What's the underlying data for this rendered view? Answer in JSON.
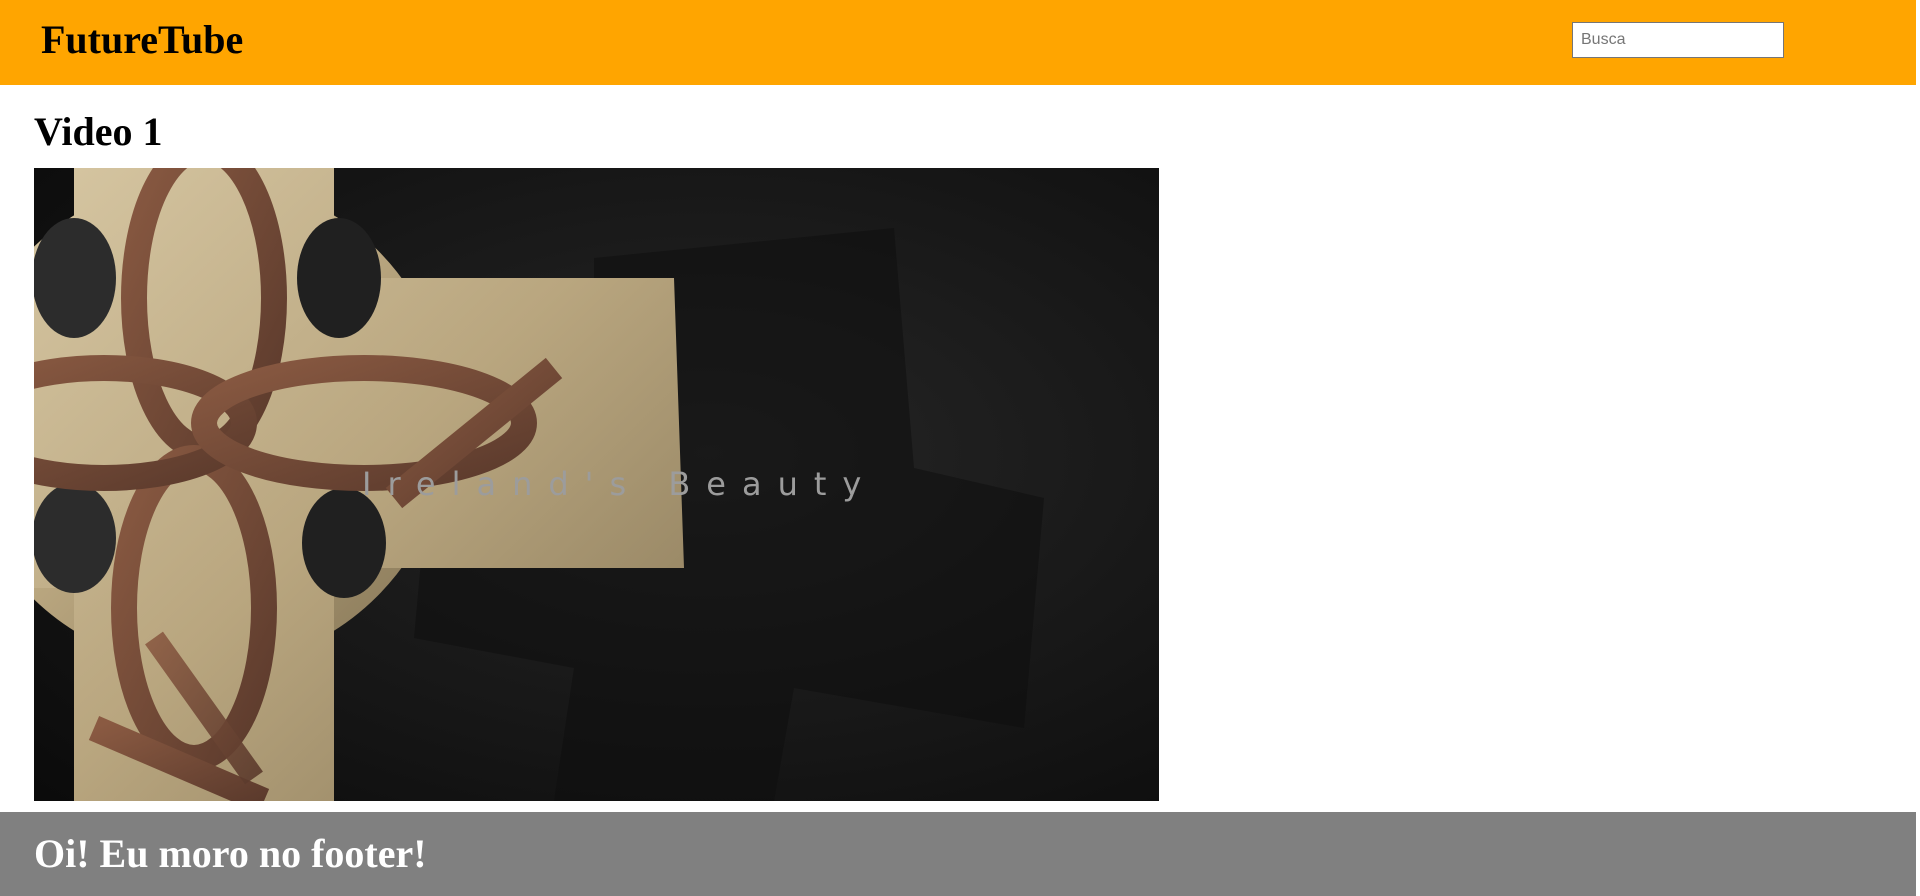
{
  "header": {
    "site_title": "FutureTube",
    "search_placeholder": "Busca",
    "background_color": "#ffa500"
  },
  "main": {
    "video_title": "Video 1",
    "video_overlay_text": "Ireland's Beauty"
  },
  "footer": {
    "text": "Oi! Eu moro no footer!",
    "background_color": "#808080"
  }
}
